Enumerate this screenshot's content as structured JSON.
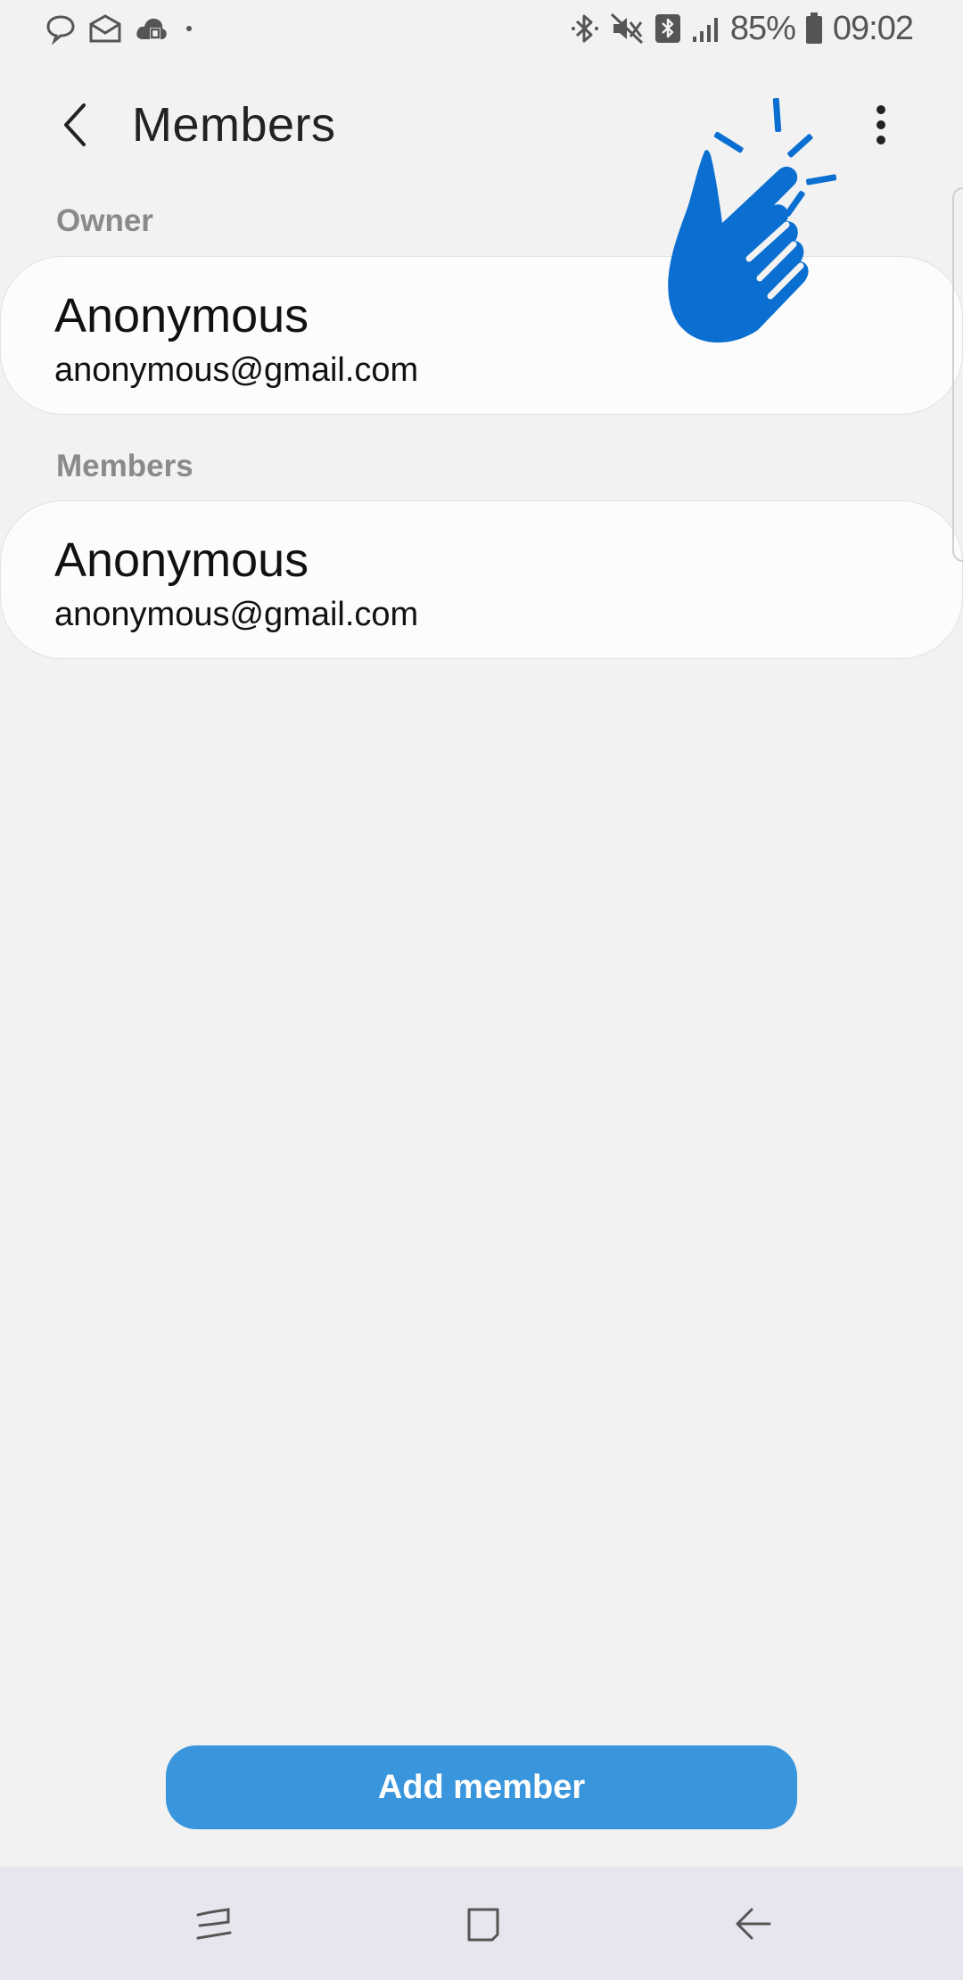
{
  "status_bar": {
    "left_icons": [
      "chat-bubble-icon",
      "mail-icon",
      "cloud-icon",
      "dot-icon"
    ],
    "right_icons": [
      "bluetooth-icon",
      "mute-icon",
      "bluetooth-box-icon",
      "signal-icon",
      "battery-icon"
    ],
    "battery_percent": "85%",
    "time": "09:02"
  },
  "app_bar": {
    "title": "Members"
  },
  "owner_section": {
    "header": "Owner",
    "member": {
      "name": "Anonymous",
      "email": "anonymous@gmail.com"
    }
  },
  "members_section": {
    "header": "Members",
    "items": [
      {
        "name": "Anonymous",
        "email": "anonymous@gmail.com"
      }
    ]
  },
  "actions": {
    "add_member_label": "Add member"
  },
  "colors": {
    "background": "#f2f2f2",
    "card": "#fcfcfc",
    "accent": "#3a96dc",
    "tap_hand": "#0a6fd1",
    "nav_bar": "#e6e6ee"
  },
  "nav_bar": {
    "icons": [
      "recent-apps-icon",
      "home-icon",
      "back-nav-icon"
    ]
  }
}
